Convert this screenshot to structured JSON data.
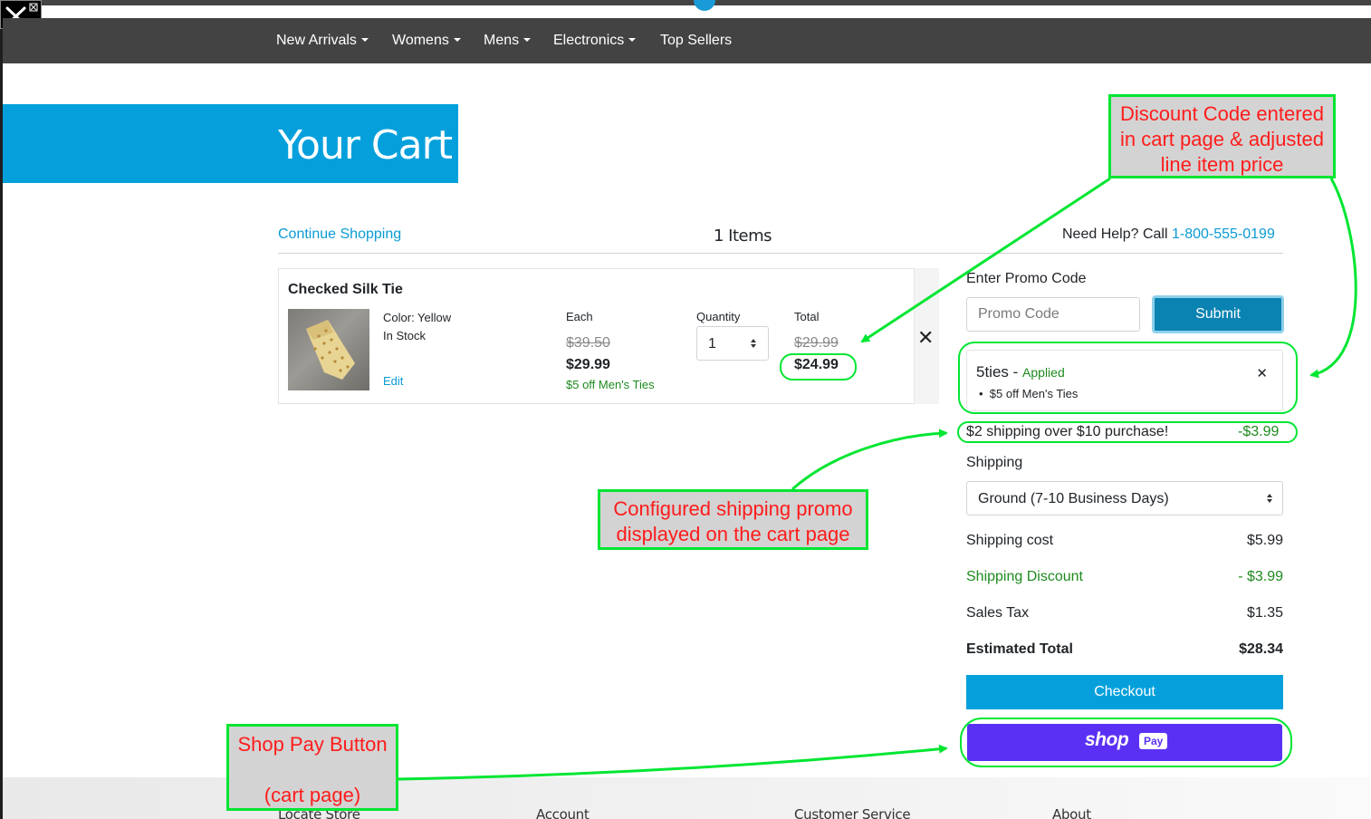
{
  "nav": {
    "items": [
      {
        "label": "New Arrivals",
        "dropdown": true
      },
      {
        "label": "Womens",
        "dropdown": true
      },
      {
        "label": "Mens",
        "dropdown": true
      },
      {
        "label": "Electronics",
        "dropdown": true
      },
      {
        "label": "Top Sellers",
        "dropdown": false
      }
    ]
  },
  "hero": {
    "title": "Your Cart"
  },
  "cart_header": {
    "continue_shopping": "Continue Shopping",
    "items_count": "1 Items",
    "need_help": "Need Help? Call",
    "phone": "1-800-555-0199"
  },
  "line_item": {
    "name": "Checked Silk Tie",
    "color": "Color: Yellow",
    "stock": "In Stock",
    "edit": "Edit",
    "each_label": "Each",
    "each_old": "$39.50",
    "each_price": "$29.99",
    "promo_note": "$5 off Men's Ties",
    "quantity_label": "Quantity",
    "quantity": "1",
    "total_label": "Total",
    "total_old": "$29.99",
    "total_price": "$24.99",
    "remove": "✕"
  },
  "promo": {
    "label": "Enter Promo Code",
    "placeholder": "Promo Code",
    "submit": "Submit",
    "applied_code": "5ties",
    "applied_sep": " - ",
    "applied_status": "Applied",
    "applied_detail": "$5 off Men's Ties",
    "remove": "✕"
  },
  "shipping_promo": {
    "text": "$2 shipping over $10 purchase!",
    "amount": "-$3.99"
  },
  "shipping": {
    "label": "Shipping",
    "selected": "Ground (7-10 Business Days)"
  },
  "summary": {
    "shipping_cost_label": "Shipping cost",
    "shipping_cost": "$5.99",
    "shipping_discount_label": "Shipping Discount",
    "shipping_discount": "- $3.99",
    "sales_tax_label": "Sales Tax",
    "sales_tax": "$1.35",
    "estimated_total_label": "Estimated Total",
    "estimated_total": "$28.34"
  },
  "checkout": {
    "label": "Checkout"
  },
  "shoppay": {
    "word": "shop",
    "pay": "Pay"
  },
  "footer": {
    "items": [
      "Locate Store",
      "Account",
      "Customer Service",
      "About"
    ]
  },
  "annotations": {
    "discount": [
      "Discount Code entered",
      "in cart page & adjusted",
      "line item price"
    ],
    "shipping_promo": [
      "Configured shipping promo",
      "displayed on the cart page"
    ],
    "shoppay": [
      "Shop Pay Button",
      "",
      "(cart page)"
    ]
  },
  "colors": {
    "accent": "#05a0dc",
    "nav": "#434343",
    "annotation_green": "#00e632",
    "annotation_red": "#ff1c1c",
    "shoppay": "#5a31f4"
  }
}
